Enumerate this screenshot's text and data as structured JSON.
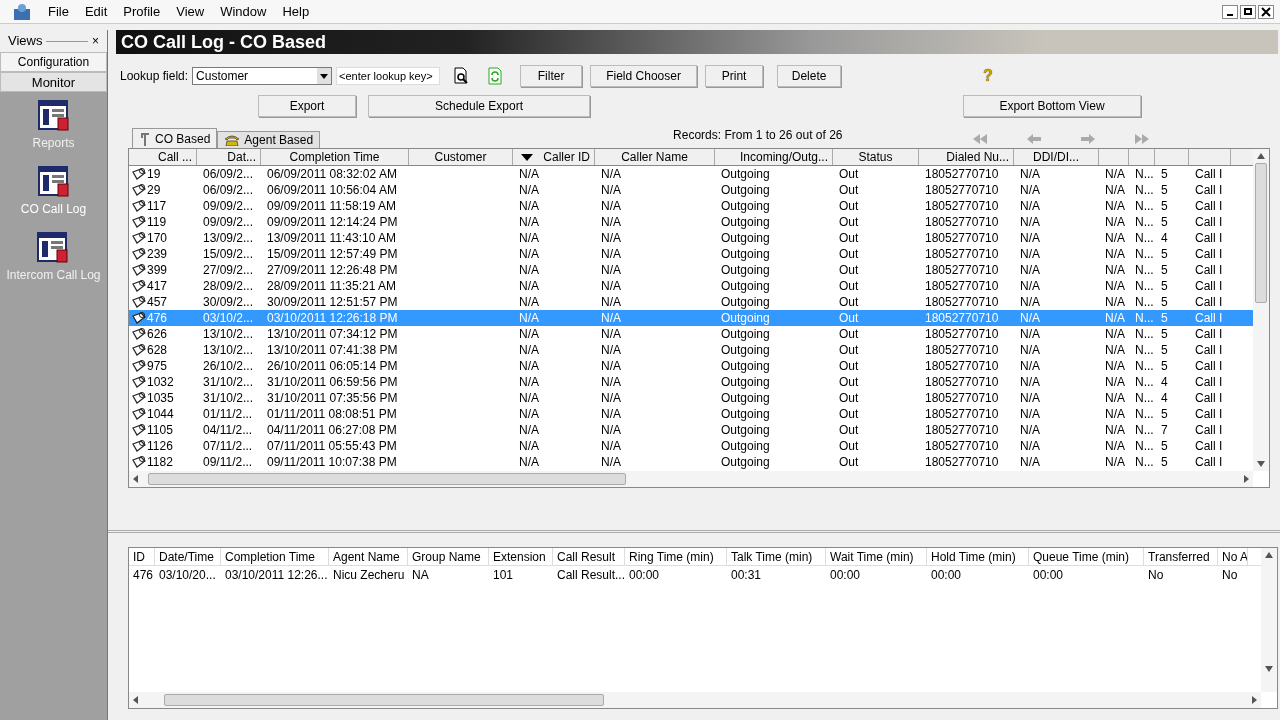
{
  "menu": [
    "File",
    "Edit",
    "Profile",
    "View",
    "Window",
    "Help"
  ],
  "sidebar": {
    "title": "Views",
    "close": "×",
    "sections": [
      {
        "label": "Configuration",
        "selected": false
      },
      {
        "label": "Monitor",
        "selected": true
      }
    ],
    "items": [
      {
        "label": "Reports",
        "selected": false
      },
      {
        "label": "CO Call Log",
        "selected": true
      },
      {
        "label": "Intercom Call Log",
        "selected": false
      }
    ]
  },
  "title": "CO Call Log - CO Based",
  "toolbar": {
    "lookup_label": "Lookup field:",
    "lookup_value": "Customer",
    "key_placeholder": "<enter lookup key>",
    "buttons": [
      "Filter",
      "Field Chooser",
      "Print",
      "Delete"
    ],
    "export_buttons": [
      "Export",
      "Schedule Export"
    ],
    "export_bottom": "Export Bottom View",
    "help": "?"
  },
  "tabs": [
    {
      "label": "CO Based",
      "selected": true
    },
    {
      "label": "Agent Based",
      "selected": false
    }
  ],
  "records": "Records: From 1 to 26 out of 26",
  "grid": {
    "columns": [
      "Call ...",
      "Dat...",
      "Completion Time",
      "Customer",
      "Caller ID",
      "Caller Name",
      "Incoming/Outg...",
      "Status",
      "Dialed Nu...",
      "DDI/DI...",
      "",
      "",
      "",
      ""
    ],
    "rows": [
      {
        "selected": false,
        "cells": [
          "19",
          "06/09/2...",
          "06/09/2011 08:32:02 AM",
          "",
          "N/A",
          "N/A",
          "Outgoing",
          "Out",
          "18052770710",
          "N/A",
          "N/A",
          "N...",
          "5",
          "Call I"
        ]
      },
      {
        "selected": false,
        "cells": [
          "29",
          "06/09/2...",
          "06/09/2011 10:56:04 AM",
          "",
          "N/A",
          "N/A",
          "Outgoing",
          "Out",
          "18052770710",
          "N/A",
          "N/A",
          "N...",
          "5",
          "Call I"
        ]
      },
      {
        "selected": false,
        "cells": [
          "117",
          "09/09/2...",
          "09/09/2011 11:58:19 AM",
          "",
          "N/A",
          "N/A",
          "Outgoing",
          "Out",
          "18052770710",
          "N/A",
          "N/A",
          "N...",
          "5",
          "Call I"
        ]
      },
      {
        "selected": false,
        "cells": [
          "119",
          "09/09/2...",
          "09/09/2011 12:14:24 PM",
          "",
          "N/A",
          "N/A",
          "Outgoing",
          "Out",
          "18052770710",
          "N/A",
          "N/A",
          "N...",
          "5",
          "Call I"
        ]
      },
      {
        "selected": false,
        "cells": [
          "170",
          "13/09/2...",
          "13/09/2011 11:43:10 AM",
          "",
          "N/A",
          "N/A",
          "Outgoing",
          "Out",
          "18052770710",
          "N/A",
          "N/A",
          "N...",
          "4",
          "Call I"
        ]
      },
      {
        "selected": false,
        "cells": [
          "239",
          "15/09/2...",
          "15/09/2011 12:57:49 PM",
          "",
          "N/A",
          "N/A",
          "Outgoing",
          "Out",
          "18052770710",
          "N/A",
          "N/A",
          "N...",
          "5",
          "Call I"
        ]
      },
      {
        "selected": false,
        "cells": [
          "399",
          "27/09/2...",
          "27/09/2011 12:26:48 PM",
          "",
          "N/A",
          "N/A",
          "Outgoing",
          "Out",
          "18052770710",
          "N/A",
          "N/A",
          "N...",
          "5",
          "Call I"
        ]
      },
      {
        "selected": false,
        "cells": [
          "417",
          "28/09/2...",
          "28/09/2011 11:35:21 AM",
          "",
          "N/A",
          "N/A",
          "Outgoing",
          "Out",
          "18052770710",
          "N/A",
          "N/A",
          "N...",
          "5",
          "Call I"
        ]
      },
      {
        "selected": false,
        "cells": [
          "457",
          "30/09/2...",
          "30/09/2011 12:51:57 PM",
          "",
          "N/A",
          "N/A",
          "Outgoing",
          "Out",
          "18052770710",
          "N/A",
          "N/A",
          "N...",
          "5",
          "Call I"
        ]
      },
      {
        "selected": true,
        "cells": [
          "476",
          "03/10/2...",
          "03/10/2011 12:26:18 PM",
          "",
          "N/A",
          "N/A",
          "Outgoing",
          "Out",
          "18052770710",
          "N/A",
          "N/A",
          "N...",
          "5",
          "Call I"
        ]
      },
      {
        "selected": false,
        "cells": [
          "626",
          "13/10/2...",
          "13/10/2011 07:34:12 PM",
          "",
          "N/A",
          "N/A",
          "Outgoing",
          "Out",
          "18052770710",
          "N/A",
          "N/A",
          "N...",
          "5",
          "Call I"
        ]
      },
      {
        "selected": false,
        "cells": [
          "628",
          "13/10/2...",
          "13/10/2011 07:41:38 PM",
          "",
          "N/A",
          "N/A",
          "Outgoing",
          "Out",
          "18052770710",
          "N/A",
          "N/A",
          "N...",
          "5",
          "Call I"
        ]
      },
      {
        "selected": false,
        "cells": [
          "975",
          "26/10/2...",
          "26/10/2011 06:05:14 PM",
          "",
          "N/A",
          "N/A",
          "Outgoing",
          "Out",
          "18052770710",
          "N/A",
          "N/A",
          "N...",
          "5",
          "Call I"
        ]
      },
      {
        "selected": false,
        "cells": [
          "1032",
          "31/10/2...",
          "31/10/2011 06:59:56 PM",
          "",
          "N/A",
          "N/A",
          "Outgoing",
          "Out",
          "18052770710",
          "N/A",
          "N/A",
          "N...",
          "4",
          "Call I"
        ]
      },
      {
        "selected": false,
        "cells": [
          "1035",
          "31/10/2...",
          "31/10/2011 07:35:56 PM",
          "",
          "N/A",
          "N/A",
          "Outgoing",
          "Out",
          "18052770710",
          "N/A",
          "N/A",
          "N...",
          "4",
          "Call I"
        ]
      },
      {
        "selected": false,
        "cells": [
          "1044",
          "01/11/2...",
          "01/11/2011 08:08:51 PM",
          "",
          "N/A",
          "N/A",
          "Outgoing",
          "Out",
          "18052770710",
          "N/A",
          "N/A",
          "N...",
          "5",
          "Call I"
        ]
      },
      {
        "selected": false,
        "cells": [
          "1105",
          "04/11/2...",
          "04/11/2011 06:27:08 PM",
          "",
          "N/A",
          "N/A",
          "Outgoing",
          "Out",
          "18052770710",
          "N/A",
          "N/A",
          "N...",
          "7",
          "Call I"
        ]
      },
      {
        "selected": false,
        "cells": [
          "1126",
          "07/11/2...",
          "07/11/2011 05:55:43 PM",
          "",
          "N/A",
          "N/A",
          "Outgoing",
          "Out",
          "18052770710",
          "N/A",
          "N/A",
          "N...",
          "5",
          "Call I"
        ]
      },
      {
        "selected": false,
        "cells": [
          "1182",
          "09/11/2...",
          "09/11/2011 10:07:38 PM",
          "",
          "N/A",
          "N/A",
          "Outgoing",
          "Out",
          "18052770710",
          "N/A",
          "N/A",
          "N...",
          "5",
          "Call I"
        ]
      }
    ]
  },
  "bottom_grid": {
    "columns": [
      "ID",
      "Date/Time",
      "Completion Time",
      "Agent Name",
      "Group Name",
      "Extension",
      "Call Result",
      "Ring Time (min)",
      "Talk Time (min)",
      "Wait Time (min)",
      "Hold Time (min)",
      "Queue Time (min)",
      "Transferred",
      "No A"
    ],
    "rows": [
      {
        "cells": [
          "476",
          "03/10/20...",
          "03/10/2011 12:26...",
          "Nicu Zecheru",
          "NA",
          "101",
          "Call Result...",
          "00:00",
          "00:31",
          "00:00",
          "00:00",
          "00:00",
          "No",
          "No"
        ]
      }
    ]
  }
}
